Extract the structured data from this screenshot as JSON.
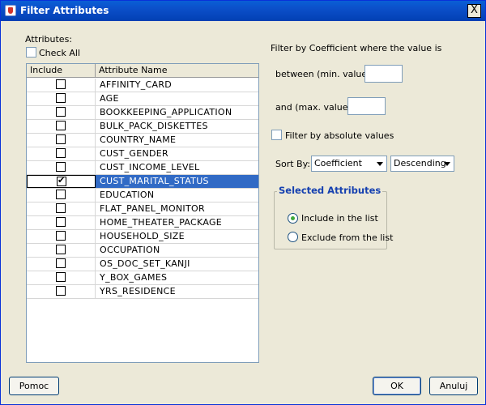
{
  "window": {
    "title": "Filter Attributes",
    "close_glyph": "X"
  },
  "left": {
    "attributes_label": "Attributes:",
    "check_all_label": "Check All",
    "check_all_checked": false,
    "table": {
      "columns": [
        "Include",
        "Attribute Name"
      ],
      "rows": [
        {
          "name": "AFFINITY_CARD",
          "checked": false,
          "selected": false
        },
        {
          "name": "AGE",
          "checked": false,
          "selected": false
        },
        {
          "name": "BOOKKEEPING_APPLICATION",
          "checked": false,
          "selected": false
        },
        {
          "name": "BULK_PACK_DISKETTES",
          "checked": false,
          "selected": false
        },
        {
          "name": "COUNTRY_NAME",
          "checked": false,
          "selected": false
        },
        {
          "name": "CUST_GENDER",
          "checked": false,
          "selected": false
        },
        {
          "name": "CUST_INCOME_LEVEL",
          "checked": false,
          "selected": false
        },
        {
          "name": "CUST_MARITAL_STATUS",
          "checked": true,
          "selected": true
        },
        {
          "name": "EDUCATION",
          "checked": false,
          "selected": false
        },
        {
          "name": "FLAT_PANEL_MONITOR",
          "checked": false,
          "selected": false
        },
        {
          "name": "HOME_THEATER_PACKAGE",
          "checked": false,
          "selected": false
        },
        {
          "name": "HOUSEHOLD_SIZE",
          "checked": false,
          "selected": false
        },
        {
          "name": "OCCUPATION",
          "checked": false,
          "selected": false
        },
        {
          "name": "OS_DOC_SET_KANJI",
          "checked": false,
          "selected": false
        },
        {
          "name": "Y_BOX_GAMES",
          "checked": false,
          "selected": false
        },
        {
          "name": "YRS_RESIDENCE",
          "checked": false,
          "selected": false
        }
      ]
    }
  },
  "right": {
    "filter_heading": "Filter by Coefficient where the value is",
    "between_label": "between (min. value):",
    "min_value": "",
    "and_label": "and (max. value):",
    "max_value": "",
    "absolute_label": "Filter by absolute values",
    "absolute_checked": false,
    "sort_by_label": "Sort By:",
    "sort_field": "Coefficient",
    "sort_order": "Descending",
    "selected_group_title": "Selected Attributes",
    "include_label": "Include in the list",
    "exclude_label": "Exclude from the list",
    "include_selected": true
  },
  "footer": {
    "help_label": "Pomoc",
    "ok_label": "OK",
    "cancel_label": "Anuluj"
  },
  "colors": {
    "titlebar": "#0a5fd6",
    "selection": "#316ac5",
    "group_title": "#1540b0"
  }
}
